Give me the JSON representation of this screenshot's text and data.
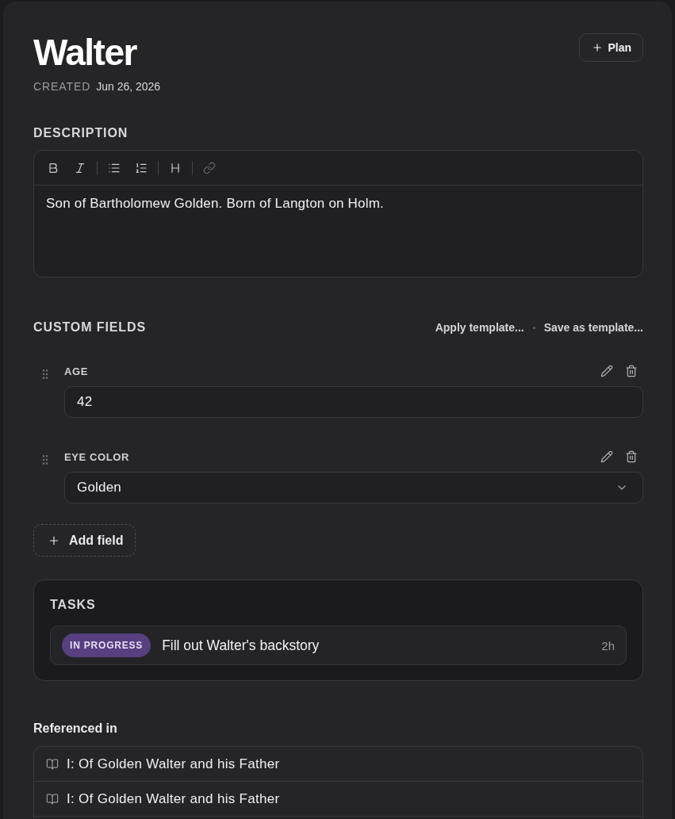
{
  "header": {
    "title": "Walter",
    "created_label": "CREATED",
    "created_date": "Jun 26, 2026",
    "plan_button": "Plan"
  },
  "description": {
    "heading": "DESCRIPTION",
    "toolbar": [
      [
        {
          "kind": "bold",
          "disabled": false
        },
        {
          "kind": "italic",
          "disabled": false
        }
      ],
      [
        {
          "kind": "bullet_list",
          "disabled": false
        },
        {
          "kind": "ordered_list",
          "disabled": false
        }
      ],
      [
        {
          "kind": "heading",
          "disabled": false
        }
      ],
      [
        {
          "kind": "link",
          "disabled": true
        }
      ]
    ],
    "text": "Son of Bartholomew Golden. Born of Langton on Holm."
  },
  "custom_fields": {
    "heading": "CUSTOM FIELDS",
    "actions": [
      "Apply template...",
      "Save as template..."
    ],
    "fields": [
      {
        "kind": "text",
        "label": "AGE",
        "value": "42"
      },
      {
        "kind": "select",
        "label": "EYE COLOR",
        "value": "Golden"
      }
    ],
    "add_button": "Add field"
  },
  "tasks": {
    "heading": "TASKS",
    "items": [
      {
        "status": "IN PROGRESS",
        "color": "#573f80",
        "title": "Fill out Walter's backstory",
        "time": "2h"
      }
    ]
  },
  "referenced_in": {
    "heading": "Referenced in",
    "items": [
      {
        "title": "I: Of Golden Walter and his Father"
      },
      {
        "title": "I: Of Golden Walter and his Father"
      }
    ]
  }
}
